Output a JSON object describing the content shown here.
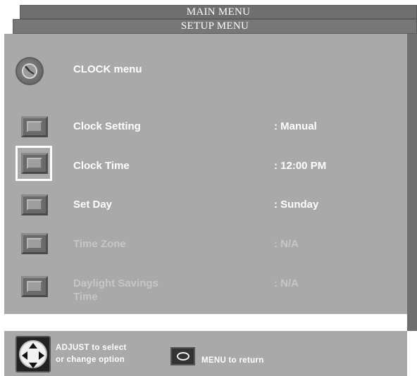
{
  "tabs": {
    "main_menu": "MAIN MENU",
    "setup_menu": "SETUP MENU"
  },
  "header": {
    "icon": "clock-icon",
    "title": "CLOCK menu"
  },
  "rows": [
    {
      "label": "Clock Setting",
      "value": ":  Manual",
      "enabled": true
    },
    {
      "label": "Clock Time",
      "value": ": 12:00 PM",
      "enabled": true,
      "selected": true
    },
    {
      "label": "Set Day",
      "value": ": Sunday",
      "enabled": true
    },
    {
      "label": "Time Zone",
      "value": ": N/A",
      "enabled": false
    },
    {
      "label_line1": "Daylight Savings",
      "label_line2": "Time",
      "value": ": N/A",
      "enabled": false
    }
  ],
  "footer": {
    "adjust_line1": "ADJUST to select",
    "adjust_line2": "or change option",
    "menu_return": "MENU  to  return"
  },
  "colors": {
    "panel": "#a9a9a9",
    "tab": "#6f6f6f",
    "text": "#ffffff",
    "disabled_text": "#c6c6c6"
  }
}
